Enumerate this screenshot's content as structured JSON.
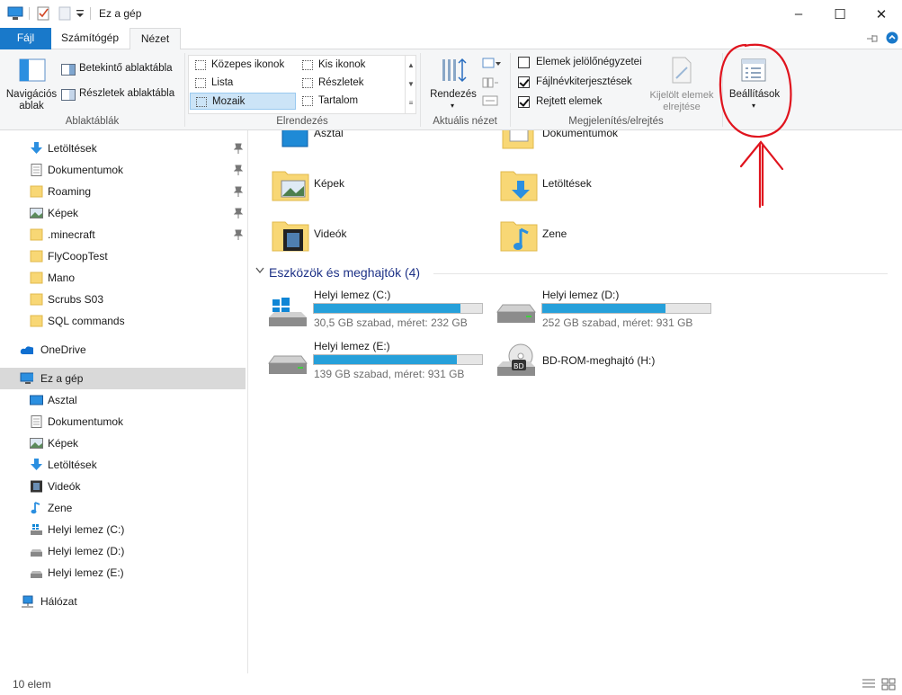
{
  "window": {
    "title": "Ez a gép",
    "controls": [
      "–",
      "☐",
      "✕"
    ]
  },
  "tabs": [
    "Fájl",
    "Számítógép",
    "Nézet"
  ],
  "ribbon": {
    "panes": {
      "nav_pane_label": "Navigációs ablak",
      "preview_label": "Betekintő ablaktábla",
      "details_label": "Részletek ablaktábla",
      "group": "Ablaktáblák"
    },
    "layout": {
      "items": [
        "Közepes ikonok",
        "Kis ikonok",
        "Lista",
        "Részletek",
        "Mozaik",
        "Tartalom"
      ],
      "selected": "Mozaik",
      "group": "Elrendezés"
    },
    "current_view": {
      "sort_label": "Rendezés",
      "group": "Aktuális nézet"
    },
    "show_hide": {
      "checkboxes": [
        {
          "label": "Elemek jelölőnégyzetei",
          "checked": false
        },
        {
          "label": "Fájlnévkiterjesztések",
          "checked": true
        },
        {
          "label": "Rejtett elemek",
          "checked": true
        }
      ],
      "hide_selected_label": "Kijelölt elemek elrejtése",
      "group": "Megjelenítés/elrejtés"
    },
    "options_label": "Beállítások"
  },
  "nav": {
    "quick": [
      {
        "label": "Letöltések",
        "icon": "download-icon",
        "pinned": true
      },
      {
        "label": "Dokumentumok",
        "icon": "document-icon",
        "pinned": true
      },
      {
        "label": "Roaming",
        "icon": "folder-icon",
        "pinned": true
      },
      {
        "label": "Képek",
        "icon": "pictures-icon",
        "pinned": true
      },
      {
        "label": ".minecraft",
        "icon": "folder-icon",
        "pinned": true
      },
      {
        "label": "FlyCoopTest",
        "icon": "folder-icon",
        "pinned": false
      },
      {
        "label": "Mano",
        "icon": "folder-icon",
        "pinned": false
      },
      {
        "label": "Scrubs S03",
        "icon": "folder-icon",
        "pinned": false
      },
      {
        "label": "SQL commands",
        "icon": "folder-icon",
        "pinned": false
      }
    ],
    "onedrive": "OneDrive",
    "thispc": "Ez a gép",
    "pc_items": [
      "Asztal",
      "Dokumentumok",
      "Képek",
      "Letöltések",
      "Videók",
      "Zene",
      "Helyi lemez (C:)",
      "Helyi lemez (D:)",
      "Helyi lemez (E:)"
    ],
    "network": "Hálózat"
  },
  "content": {
    "folders": [
      "Asztal",
      "Dokumentumok",
      "Képek",
      "Letöltések",
      "Videók",
      "Zene"
    ],
    "section_title": "Eszközök és meghajtók (4)",
    "drives": [
      {
        "name": "Helyi lemez (C:)",
        "info": "30,5 GB szabad, méret: 232 GB",
        "used_fraction": 0.87
      },
      {
        "name": "Helyi lemez (D:)",
        "info": "252 GB szabad, méret: 931 GB",
        "used_fraction": 0.73
      },
      {
        "name": "Helyi lemez (E:)",
        "info": "139 GB szabad, méret: 931 GB",
        "used_fraction": 0.85
      },
      {
        "name": "BD-ROM-meghajtó (H:)"
      }
    ]
  },
  "status": {
    "count": "10 elem"
  },
  "colors": {
    "accent": "#1979ca",
    "drive_fill": "#26a0da",
    "annotation": "#e0141e"
  }
}
